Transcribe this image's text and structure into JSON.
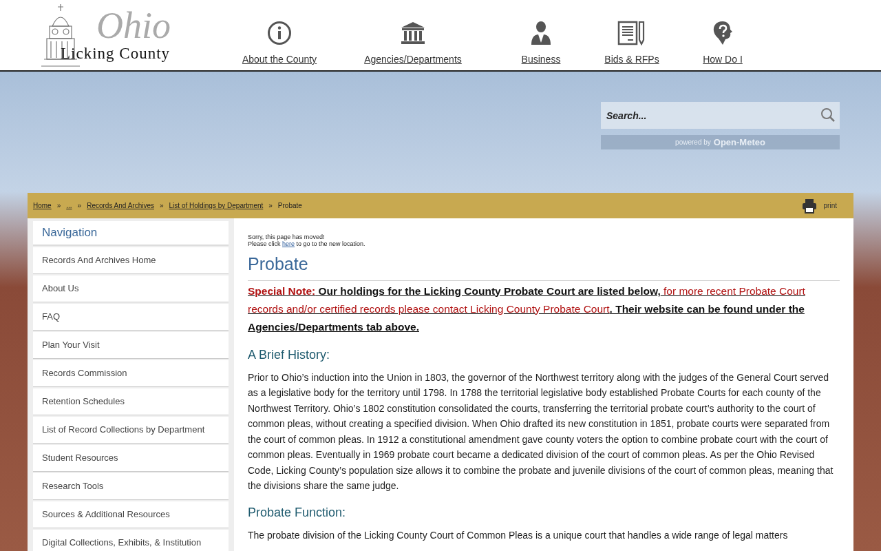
{
  "logo": {
    "script": "Ohio",
    "name": "Licking County"
  },
  "main_nav": [
    {
      "label": "About the County"
    },
    {
      "label": "Agencies/Departments"
    },
    {
      "label": "Business"
    },
    {
      "label": "Bids & RFPs"
    },
    {
      "label": "How Do I"
    }
  ],
  "search": {
    "placeholder": "Search...",
    "powered_by": "powered by",
    "provider": "Open-Meteo"
  },
  "breadcrumb": [
    "Home",
    "...",
    "Records And Archives",
    "List of Holdings by Department",
    "Probate"
  ],
  "breadcrumb_separator": "»",
  "print_label": "print",
  "sidebar": {
    "title": "Navigation",
    "items": [
      "Records And Archives Home",
      "About Us",
      "FAQ",
      "Plan Your Visit",
      "Records Commission",
      "Retention Schedules",
      "List of Record Collections by Department",
      "Student Resources",
      "Research Tools",
      "Sources & Additional Resources",
      "Digital Collections, Exhibits, & Institution"
    ]
  },
  "moved_notice": {
    "line1": "Sorry, this page has moved!",
    "before": "Please click",
    "link": "here",
    "after": "to go to the new location."
  },
  "page_title": "Probate",
  "special_note": [
    {
      "kind": "label",
      "text": " Special Note:"
    },
    {
      "kind": "text",
      "text": " Our holdings for the Licking County Probate Court are listed below,"
    },
    {
      "kind": "link",
      "text": " for more recent Probate Court records and/or certified records please contact Licking County Probate Court"
    },
    {
      "kind": "text",
      "text": ". Their website can be found under the Agencies/Departments tab above."
    }
  ],
  "sections": [
    {
      "heading": "A Brief History:",
      "paragraph": "Prior to Ohio’s induction into the Union in 1803, the governor of the Northwest territory along with the judges of the General Court served as a legislative body for the territory until 1798. In 1788 the territorial legislative body established Probate Courts for each county of the Northwest Territory. Ohio’s 1802 constitution consolidated the courts, transferring the territorial probate court’s authority to the court of common pleas, without creating a specified division. When Ohio drafted its new constitution in 1851, probate courts were separated from the court of common pleas. In 1912 a constitutional amendment gave county voters the option to combine probate court with the court of common pleas. Eventually in 1969 probate court became a dedicated division of the court of common pleas. As per the Ohio Revised Code, Licking County’s population size allows it to combine the probate and juvenile divisions of the court of common pleas, meaning that the divisions share the same judge."
    },
    {
      "heading": "Probate Function:",
      "paragraph": "The probate division of the Licking County Court of Common Pleas is a unique court that handles a wide range of legal matters"
    }
  ]
}
